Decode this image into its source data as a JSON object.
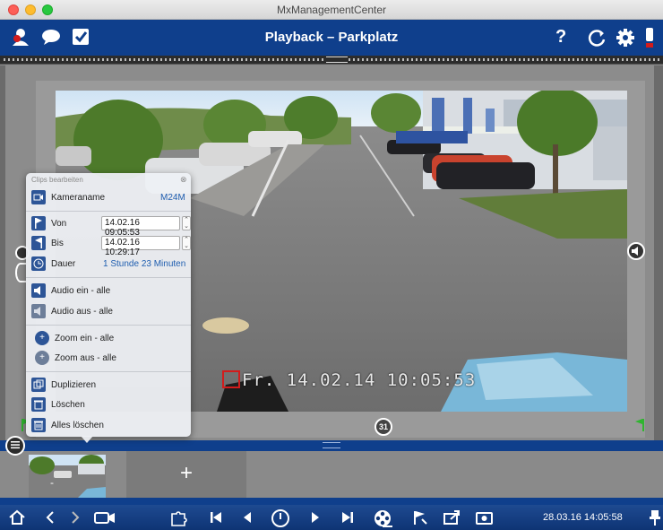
{
  "window": {
    "title": "MxManagementCenter"
  },
  "header": {
    "title": "Playback – Parkplatz",
    "help_label": "?",
    "left_icons": [
      "user-alert-icon",
      "chat-icon",
      "checkbox-icon"
    ],
    "right_icons": [
      "help-icon",
      "refresh-icon",
      "settings-icon",
      "alert-icon"
    ]
  },
  "video": {
    "osd_text": "Fr. 14.02.14 10:05:53"
  },
  "clip_panel": {
    "title": "Clips bearbeiten",
    "camera_label": "Kameraname",
    "camera_value": "M24M",
    "from_label": "Von",
    "from_value": "14.02.16 09:05:53",
    "to_label": "Bis",
    "to_value": "14.02.16 10:29:17",
    "duration_label": "Dauer",
    "duration_value": "1 Stunde 23 Minuten",
    "audio_on": "Audio ein - alle",
    "audio_off": "Audio aus - alle",
    "zoom_in": "Zoom ein - alle",
    "zoom_out": "Zoom aus - alle",
    "duplicate": "Duplizieren",
    "delete": "Löschen",
    "delete_all": "Alles löschen"
  },
  "thumbnails": {
    "add_label": "+",
    "thumb_label": "-"
  },
  "toolbar": {
    "timestamp": "28.03.16 14:05:58",
    "icons": [
      "home-icon",
      "back-icon",
      "forward-icon",
      "camera-icon",
      "puzzle-icon",
      "skip-start-icon",
      "step-back-icon",
      "play-pause-icon",
      "step-forward-icon",
      "skip-end-icon",
      "film-reel-icon",
      "flag-icon",
      "export-icon",
      "snapshot-icon",
      "pin-icon"
    ]
  },
  "colors": {
    "brand_blue": "#0f3f8c",
    "accent_link": "#1f5eb0",
    "record_red": "#d21c1c",
    "marker_green": "#2fb52f"
  }
}
